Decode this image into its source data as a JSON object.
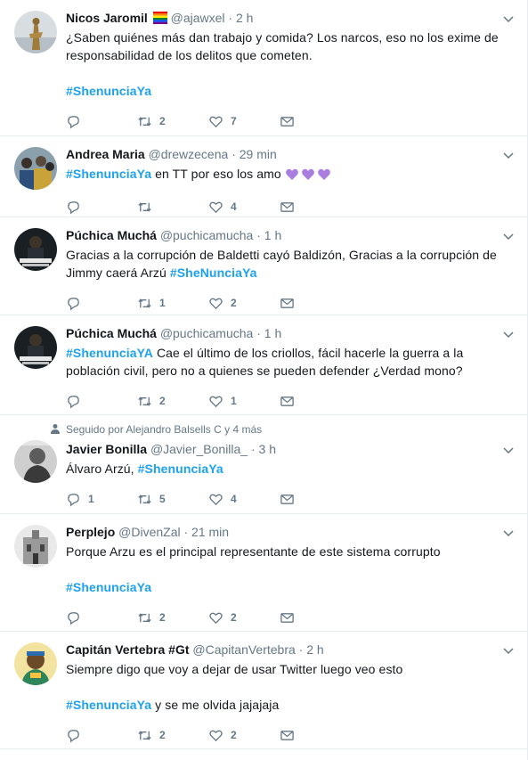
{
  "tweets": [
    {
      "name": "Nicos Jaromil",
      "has_flag": true,
      "handle": "@ajawxel",
      "time": "2 h",
      "avatar": "statue",
      "context": "",
      "line1": "¿Saben quiénes más dan trabajo y comida? Los narcos, eso no los exime de responsabilidad de los delitos que cometen.",
      "hashtag_after": "#ShenunciaYa",
      "reply": "",
      "retweet": "2",
      "like": "7"
    },
    {
      "name": "Andrea Maria",
      "handle": "@drewzecena",
      "time": "29 min",
      "avatar": "crowd",
      "hashtag_lead": "#ShenunciaYa",
      "line1": " en TT por eso los amo ",
      "emoji": "purple-hearts",
      "reply": "",
      "retweet": "",
      "like": "4"
    },
    {
      "name": "Púchica Muchá",
      "handle": "@puchicamucha",
      "time": "1 h",
      "avatar": "poster",
      "line1": "Gracias a la corrupción de Baldetti cayó Baldizón, Gracias a la corrupción de Jimmy caerá Arzú ",
      "hashtag_tail": "#SheNunciaYa",
      "reply": "",
      "retweet": "1",
      "like": "2"
    },
    {
      "name": "Púchica Muchá",
      "handle": "@puchicamucha",
      "time": "1 h",
      "avatar": "poster",
      "hashtag_lead": "#ShenunciaYA",
      "line1": " Cae el último de los criollos, fácil hacerle la guerra a la población civil, pero no a quienes se pueden defender ¿Verdad mono?",
      "reply": "",
      "retweet": "2",
      "like": "1"
    },
    {
      "context": "Seguido por Alejandro Balsells C y 4 más",
      "name": "Javier Bonilla",
      "handle": "@Javier_Bonilla_",
      "time": "3 h",
      "avatar": "portrait",
      "line1": "Álvaro Arzú, ",
      "hashtag_tail": "#ShenunciaYa",
      "reply": "1",
      "retweet": "5",
      "like": "4"
    },
    {
      "name": "Perplejo",
      "handle": "@DivenZal",
      "time": "21 min",
      "avatar": "church",
      "line1": "Porque Arzu es el principal representante de este sistema corrupto",
      "hashtag_after": "#ShenunciaYa",
      "reply": "",
      "retweet": "2",
      "like": "2"
    },
    {
      "name": "Capitán Vertebra #Gt",
      "handle": "@CapitanVertebra",
      "time": "2 h",
      "avatar": "cartoon",
      "line1": "Siempre digo que voy a dejar de usar Twitter luego veo esto",
      "hashtag_para": "#ShenunciaYa",
      "para_tail": " y se me olvida jajajaja",
      "reply": "",
      "retweet": "2",
      "like": "2"
    }
  ],
  "labels": {
    "sep": "·"
  },
  "colors": {
    "link": "#1da1f2",
    "muted": "#657786",
    "border": "#e6ecf0"
  }
}
